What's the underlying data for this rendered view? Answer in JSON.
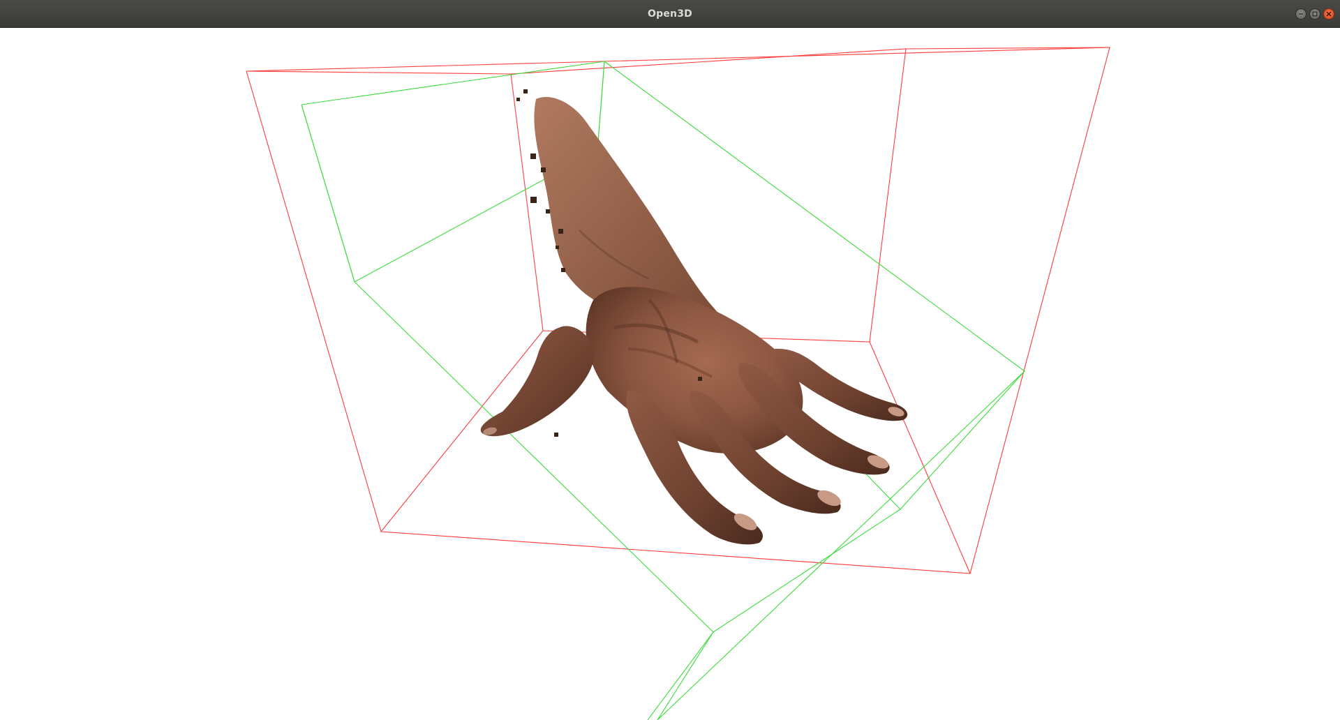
{
  "window": {
    "title": "Open3D"
  },
  "controls": {
    "minimize_icon": "minimize-icon",
    "maximize_icon": "maximize-icon",
    "close_icon": "close-icon"
  },
  "scene": {
    "background": "#ffffff",
    "objects": [
      {
        "name": "hand-point-cloud",
        "color": "#8a5a45"
      },
      {
        "name": "red-bounding-box",
        "color": "#ff3b3b"
      },
      {
        "name": "green-bounding-box",
        "color": "#3bdc3b"
      }
    ]
  }
}
